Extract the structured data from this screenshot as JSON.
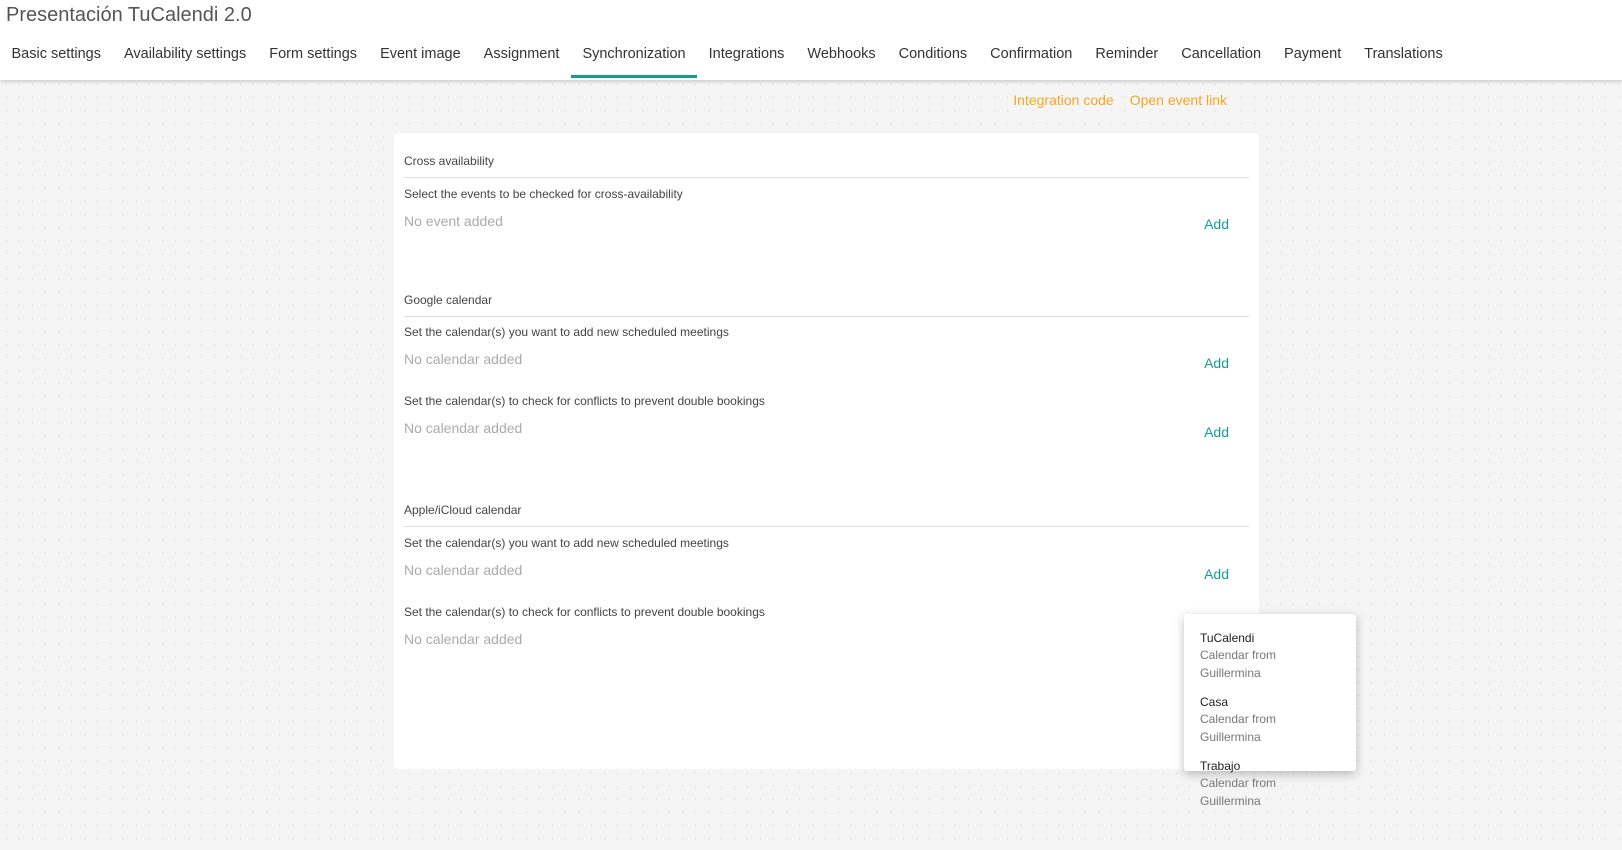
{
  "title": "Presentación TuCalendi 2.0",
  "tabs": [
    "Basic settings",
    "Availability settings",
    "Form settings",
    "Event image",
    "Assignment",
    "Synchronization",
    "Integrations",
    "Webhooks",
    "Conditions",
    "Confirmation",
    "Reminder",
    "Cancellation",
    "Payment",
    "Translations"
  ],
  "active_tab": "Synchronization",
  "links": {
    "integration_code": "Integration code",
    "open_event_link": "Open event link"
  },
  "cross": {
    "heading": "Cross availability",
    "label": "Select the events to be checked for cross-availability",
    "empty": "No event added",
    "add": "Add"
  },
  "google": {
    "heading": "Google calendar",
    "add_label": "Set the calendar(s) you want to add new scheduled meetings",
    "add_empty": "No calendar added",
    "check_label": "Set the calendar(s) to check for conflicts to prevent double bookings",
    "check_empty": "No calendar added",
    "add": "Add"
  },
  "apple": {
    "heading": "Apple/iCloud calendar",
    "add_label": "Set the calendar(s) you want to add new scheduled meetings",
    "add_empty": "No calendar added",
    "check_label": "Set the calendar(s) to check for conflicts to prevent double bookings",
    "check_empty": "No calendar added",
    "add": "Add"
  },
  "menu": [
    {
      "name": "TuCalendi",
      "sub": "Calendar from Guillermina"
    },
    {
      "name": "Casa",
      "sub": "Calendar from Guillermina"
    },
    {
      "name": "Trabajo",
      "sub": "Calendar from Guillermina"
    }
  ],
  "colors": {
    "accent": "#129e8e",
    "link": "#f5a623"
  }
}
